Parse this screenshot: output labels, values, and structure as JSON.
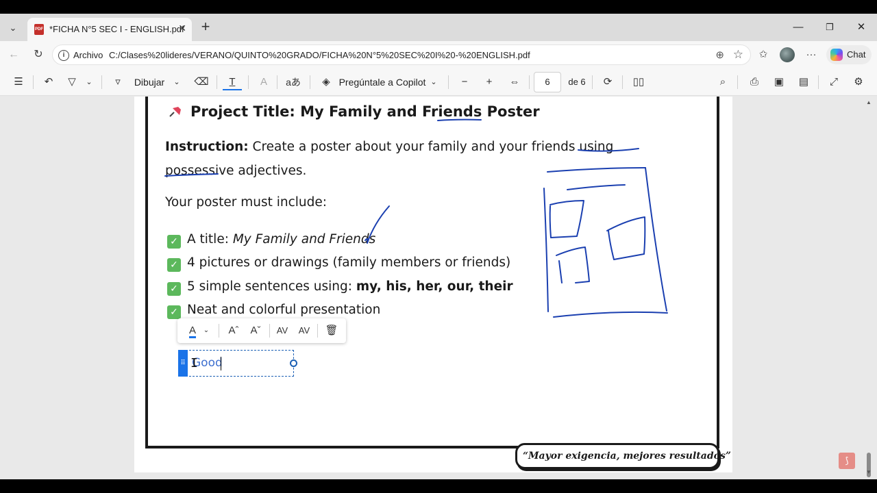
{
  "tab": {
    "title": "*FICHA N°5 SEC I - ENGLISH.pdf",
    "pdf_badge": "PDF"
  },
  "address": {
    "scheme_label": "Archivo",
    "url": "C:/Clases%20lideres/VERANO/QUINTO%20GRADO/FICHA%20N°5%20SEC%20I%20-%20ENGLISH.pdf"
  },
  "chat": {
    "label": "Chat"
  },
  "pdf_toolbar": {
    "draw_label": "Dibujar",
    "copilot_label": "Pregúntale a Copilot",
    "page_current": "6",
    "page_total": "de 6"
  },
  "document": {
    "title": "Project Title: My Family and Friends Poster",
    "instruction_label": "Instruction:",
    "instruction_text": " Create a poster about your family and your friends using possessive adjectives.",
    "must_include": "Your poster must include:",
    "items": [
      {
        "prefix": "A title: ",
        "emphasis": "My Family and Friends",
        "style": "italic"
      },
      {
        "prefix": "4 pictures or drawings (family members or friends)",
        "emphasis": "",
        "style": "none"
      },
      {
        "prefix": "5 simple sentences using: ",
        "emphasis": "my, his, her, our, their",
        "style": "bold"
      },
      {
        "prefix": "Neat and colorful presentation",
        "emphasis": "",
        "style": "none"
      }
    ],
    "textbox_value": "Good",
    "motto": "“Mayor exigencia, mejores resultados”"
  },
  "colors": {
    "ink": "#1a3fb0",
    "check_green": "#5cb85c",
    "accent": "#1a73e8"
  }
}
